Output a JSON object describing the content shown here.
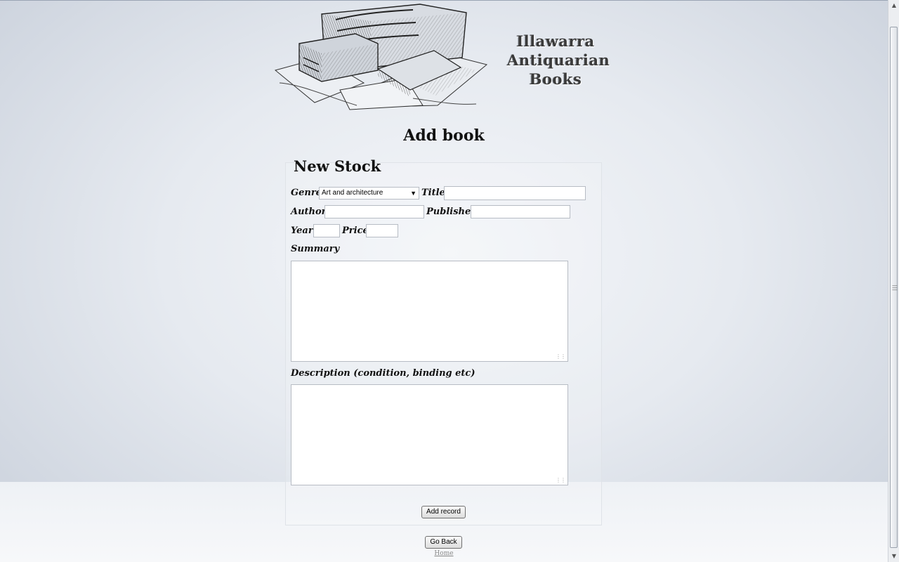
{
  "header": {
    "site_title_line1": "Illawarra",
    "site_title_line2": "Antiquarian",
    "site_title_line3": "Books",
    "illustration": "antique-books-engraving"
  },
  "page": {
    "heading": "Add book"
  },
  "form": {
    "legend": "New Stock",
    "genre_label": "Genre",
    "genre_selected": "Art and architecture",
    "title_label": "Title",
    "title_value": "",
    "author_label": "Author",
    "author_value": "",
    "publisher_label": "Publisher",
    "publisher_value": "",
    "year_label": "Year",
    "year_value": "",
    "price_label": "Price",
    "price_value": "",
    "summary_label": "Summary",
    "summary_value": "",
    "description_label": "Description (condition, binding etc)",
    "description_value": "",
    "submit_label": "Add record"
  },
  "footer": {
    "go_back_label": "Go Back",
    "home_link": "Home"
  },
  "colors": {
    "background_center": "#f4f6f9",
    "background_edge": "#c9d0db",
    "text": "#111111"
  }
}
